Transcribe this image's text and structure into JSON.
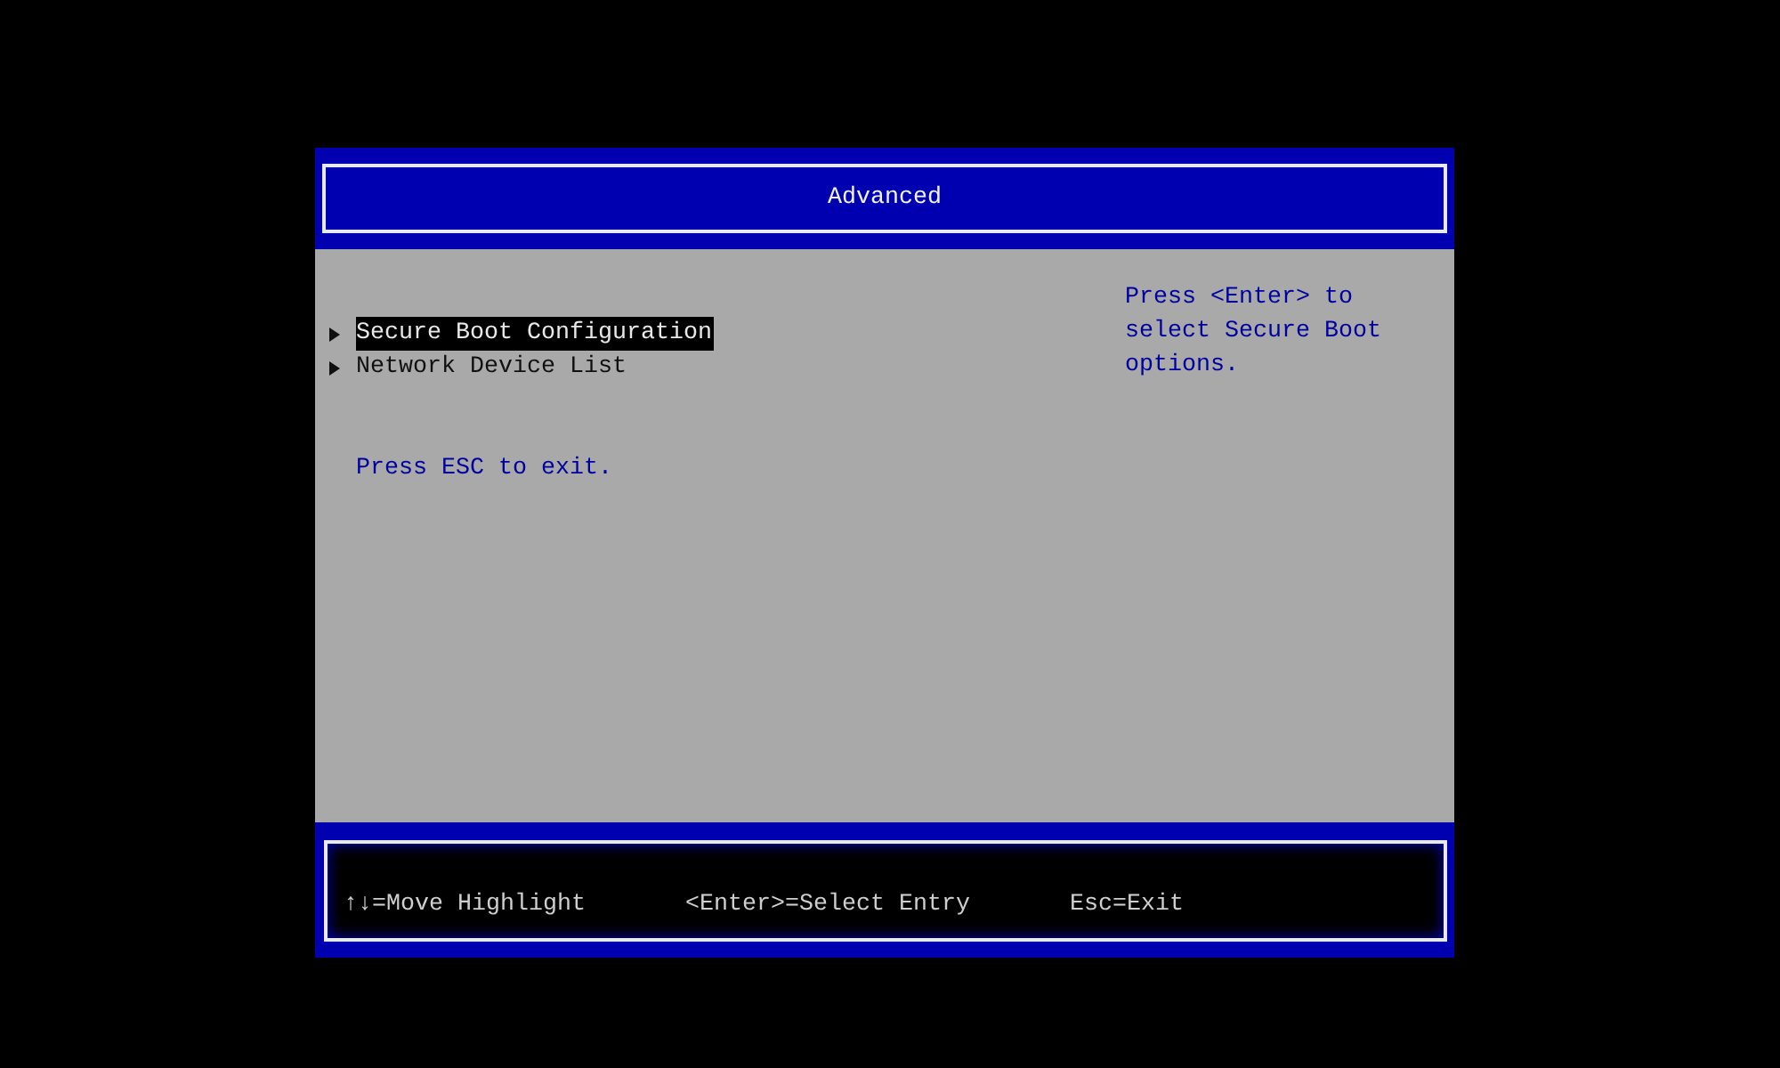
{
  "header": {
    "title": "Advanced"
  },
  "menu": {
    "items": [
      {
        "label": "Secure Boot Configuration",
        "selected": true
      },
      {
        "label": "Network Device List",
        "selected": false
      }
    ],
    "hint": "Press ESC to exit."
  },
  "help": {
    "text": "Press <Enter> to select Secure Boot options."
  },
  "footer": {
    "keys": [
      "↑↓=Move Highlight",
      "<Enter>=Select Entry",
      "Esc=Exit"
    ]
  }
}
